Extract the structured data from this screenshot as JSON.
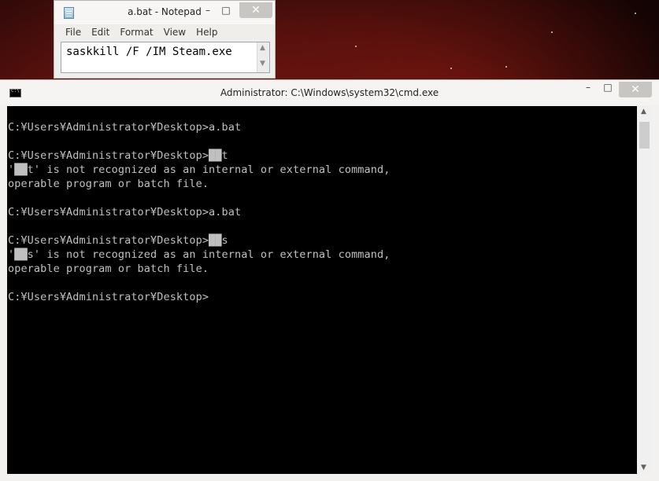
{
  "notepad": {
    "title": "a.bat - Notepad",
    "minimize": "–",
    "maximize": "□",
    "close": "✕",
    "menu": [
      "File",
      "Edit",
      "Format",
      "View",
      "Help"
    ],
    "content": "saskkill /F /IM Steam.exe",
    "scroll_up": "▲",
    "scroll_down": "▼"
  },
  "cmd": {
    "title": "Administrator: C:\\Windows\\system32\\cmd.exe",
    "minimize": "–",
    "maximize": "□",
    "close": "✕",
    "scroll_up": "▲",
    "scroll_down": "▼",
    "lines": [
      "C:¥Users¥Administrator¥Desktop>a.bat",
      "",
      "C:¥Users¥Administrator¥Desktop>██t",
      "'██t' is not recognized as an internal or external command,",
      "operable program or batch file.",
      "",
      "C:¥Users¥Administrator¥Desktop>a.bat",
      "",
      "C:¥Users¥Administrator¥Desktop>██s",
      "'██s' is not recognized as an internal or external command,",
      "operable program or batch file.",
      "",
      "C:¥Users¥Administrator¥Desktop>"
    ]
  }
}
